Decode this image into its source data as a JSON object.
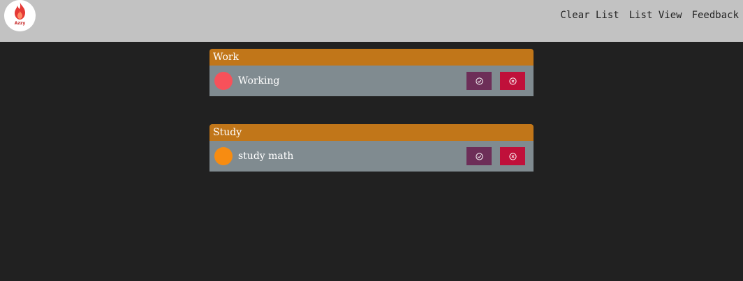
{
  "app": {
    "logo_text": "Azzy"
  },
  "nav": {
    "items": [
      "Clear List",
      "List View",
      "Feedback"
    ]
  },
  "categories": [
    {
      "title": "Work",
      "tasks": [
        {
          "label": "Working",
          "color": "#f7515a"
        }
      ]
    },
    {
      "title": "Study",
      "tasks": [
        {
          "label": "study math",
          "color": "#f78c11"
        }
      ]
    }
  ],
  "icons": {
    "logo": "flame-icon",
    "done": "check-circle-icon",
    "delete": "x-circle-icon"
  },
  "colors": {
    "header_bg": "#c2c2c2",
    "page_bg": "#212121",
    "category_header": "#c17619",
    "task_row": "#808b90",
    "done_button": "#6d2e58",
    "delete_button": "#c0103a"
  }
}
